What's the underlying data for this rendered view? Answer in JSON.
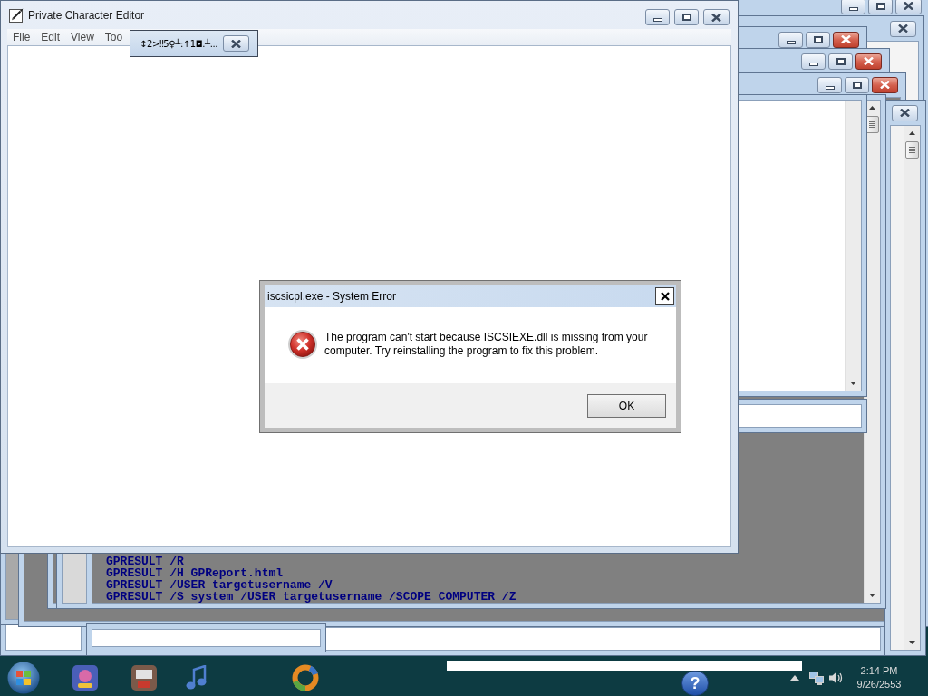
{
  "main_window": {
    "title": "Private Character Editor",
    "menu": [
      {
        "label": "File"
      },
      {
        "label": "Edit"
      },
      {
        "label": "View"
      },
      {
        "label": "Too"
      }
    ]
  },
  "floating_toolbar": {
    "text": "↕2>‼5♀┴:↑1◘.┴..."
  },
  "console": {
    "lines": [
      "GPRESULT /R",
      "GPRESULT /H GPReport.html",
      "GPRESULT /USER targetusername /V",
      "GPRESULT /S system /USER targetusername /SCOPE COMPUTER /Z"
    ]
  },
  "dialog": {
    "title": "iscsicpl.exe - System Error",
    "message": "The program can't start because ISCSIEXE.dll is missing from your computer. Try reinstalling the program to fix this problem.",
    "buttons": [
      {
        "label": "OK"
      }
    ]
  },
  "taskbar": {
    "help_glyph": "?",
    "clock": {
      "time": "2:14 PM",
      "date": "9/26/2553"
    }
  }
}
